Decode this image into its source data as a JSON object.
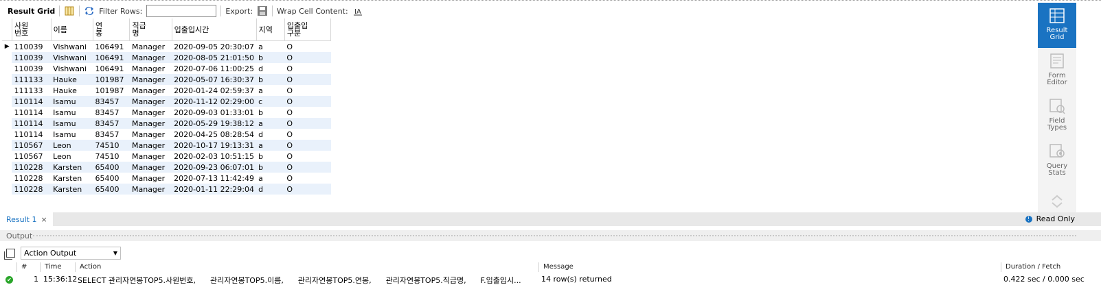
{
  "toolbar": {
    "title": "Result Grid",
    "filter_label": "Filter Rows:",
    "filter_value": "",
    "export_label": "Export:",
    "wrap_label": "Wrap Cell Content:",
    "icons": [
      "grid-columns-icon",
      "refresh-icon",
      "export-save-icon",
      "wrap-text-icon",
      "toggle-panel-icon"
    ]
  },
  "grid": {
    "columns": [
      "사원\n번호",
      "이름",
      "연\n봉",
      "직급\n명",
      "입출입시간",
      "지역",
      "입출입\n구분"
    ],
    "rows": [
      [
        "110039",
        "Vishwani",
        "106491",
        "Manager",
        "2020-09-05 20:30:07",
        "a",
        "O"
      ],
      [
        "110039",
        "Vishwani",
        "106491",
        "Manager",
        "2020-08-05 21:01:50",
        "b",
        "O"
      ],
      [
        "110039",
        "Vishwani",
        "106491",
        "Manager",
        "2020-07-06 11:00:25",
        "d",
        "O"
      ],
      [
        "111133",
        "Hauke",
        "101987",
        "Manager",
        "2020-05-07 16:30:37",
        "b",
        "O"
      ],
      [
        "111133",
        "Hauke",
        "101987",
        "Manager",
        "2020-01-24 02:59:37",
        "a",
        "O"
      ],
      [
        "110114",
        "Isamu",
        "83457",
        "Manager",
        "2020-11-12 02:29:00",
        "c",
        "O"
      ],
      [
        "110114",
        "Isamu",
        "83457",
        "Manager",
        "2020-09-03 01:33:01",
        "b",
        "O"
      ],
      [
        "110114",
        "Isamu",
        "83457",
        "Manager",
        "2020-05-29 19:38:12",
        "a",
        "O"
      ],
      [
        "110114",
        "Isamu",
        "83457",
        "Manager",
        "2020-04-25 08:28:54",
        "d",
        "O"
      ],
      [
        "110567",
        "Leon",
        "74510",
        "Manager",
        "2020-10-17 19:13:31",
        "a",
        "O"
      ],
      [
        "110567",
        "Leon",
        "74510",
        "Manager",
        "2020-02-03 10:51:15",
        "b",
        "O"
      ],
      [
        "110228",
        "Karsten",
        "65400",
        "Manager",
        "2020-09-23 06:07:01",
        "b",
        "O"
      ],
      [
        "110228",
        "Karsten",
        "65400",
        "Manager",
        "2020-07-13 11:42:49",
        "a",
        "O"
      ],
      [
        "110228",
        "Karsten",
        "65400",
        "Manager",
        "2020-01-11 22:29:04",
        "d",
        "O"
      ]
    ],
    "selected_row": 0
  },
  "side_panel": {
    "buttons": [
      {
        "label": "Result\nGrid",
        "icon": "result-grid-icon",
        "active": true
      },
      {
        "label": "Form\nEditor",
        "icon": "form-editor-icon",
        "active": false
      },
      {
        "label": "Field\nTypes",
        "icon": "field-types-icon",
        "active": false
      },
      {
        "label": "Query\nStats",
        "icon": "query-stats-icon",
        "active": false
      }
    ]
  },
  "result_tab": {
    "label": "Result 1",
    "close": "×",
    "read_only": "Read Only"
  },
  "output": {
    "title": "Output",
    "selector_value": "Action Output",
    "headers": {
      "num": "#",
      "time": "Time",
      "action": "Action",
      "message": "Message",
      "duration": "Duration / Fetch"
    },
    "entry": {
      "num": "1",
      "time": "15:36:12",
      "action": "SELECT 관리자연봉TOP5.사원번호,      관리자연봉TOP5.이름,      관리자연봉TOP5.연봉,      관리자연봉TOP5.직급명,      F.입출입시...",
      "message": "14 row(s) returned",
      "duration": "0.422 sec / 0.000 sec",
      "status_color": "#2aa52a"
    }
  },
  "colors": {
    "accent": "#1a73c2",
    "row_alt": "#e9f1fb"
  }
}
